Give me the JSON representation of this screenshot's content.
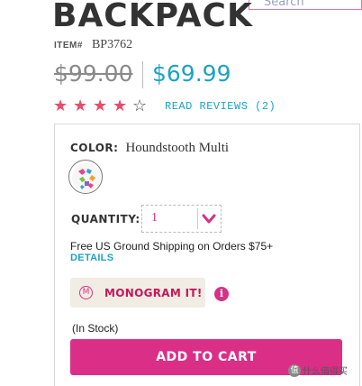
{
  "header": {
    "search_label": "Search"
  },
  "product": {
    "title": "BACKPACK",
    "item_label": "ITEM#",
    "item_number": "BP3762",
    "old_price": "$99.00",
    "new_price": "$69.99",
    "rating": 4,
    "rating_max": 5,
    "reviews_label": "READ REVIEWS (2)"
  },
  "options": {
    "color_label": "COLOR:",
    "color_value": "Houndstooth Multi",
    "swatch_icon": "houndstooth-multi-swatch",
    "quantity_label": "QUANTITY:",
    "quantity_value": "1",
    "quantity_icon": "chevron-down-icon"
  },
  "shipping": {
    "text": "Free US Ground Shipping on Orders $75+",
    "details_label": "DETAILS"
  },
  "monogram": {
    "icon_letter": "M",
    "label": "MONOGRAM IT!",
    "info_icon": "i"
  },
  "purchase": {
    "stock_status": "(In Stock)",
    "add_to_cart_label": "ADD TO CART"
  },
  "watermark": {
    "icon_glyph": "值",
    "text": "什么值得买"
  },
  "colors": {
    "accent_pink": "#db2f87",
    "link_blue": "#1ba3c6",
    "star_red": "#ea4a6a",
    "monogram_bg": "#f1ece4"
  }
}
